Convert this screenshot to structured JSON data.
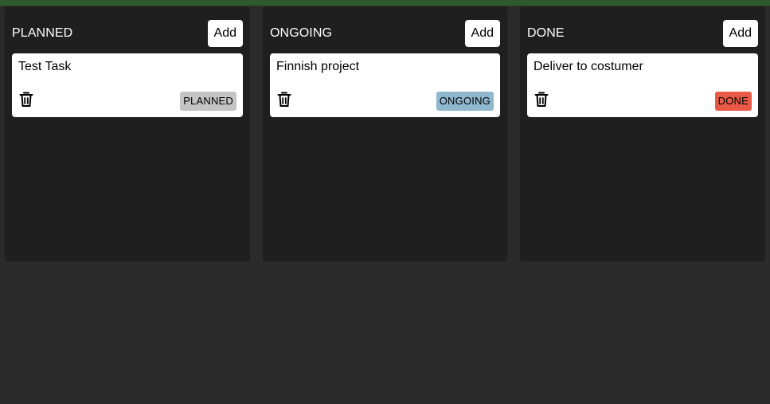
{
  "colors": {
    "top_bar": "#2f5a2f",
    "page_background": "#2b2b2b",
    "column_background": "#1f1f1f",
    "planned_badge": "#c4c4c4",
    "ongoing_badge": "#8fb8cf",
    "done_badge": "#e85a47"
  },
  "columns": [
    {
      "title": "PLANNED",
      "add_label": "Add",
      "cards": [
        {
          "title": "Test Task",
          "status": "PLANNED",
          "delete_icon": "trash-icon"
        }
      ]
    },
    {
      "title": "ONGOING",
      "add_label": "Add",
      "cards": [
        {
          "title": "Finnish project",
          "status": "ONGOING",
          "delete_icon": "trash-icon"
        }
      ]
    },
    {
      "title": "DONE",
      "add_label": "Add",
      "cards": [
        {
          "title": "Deliver to costumer",
          "status": "DONE",
          "delete_icon": "trash-icon"
        }
      ]
    }
  ]
}
